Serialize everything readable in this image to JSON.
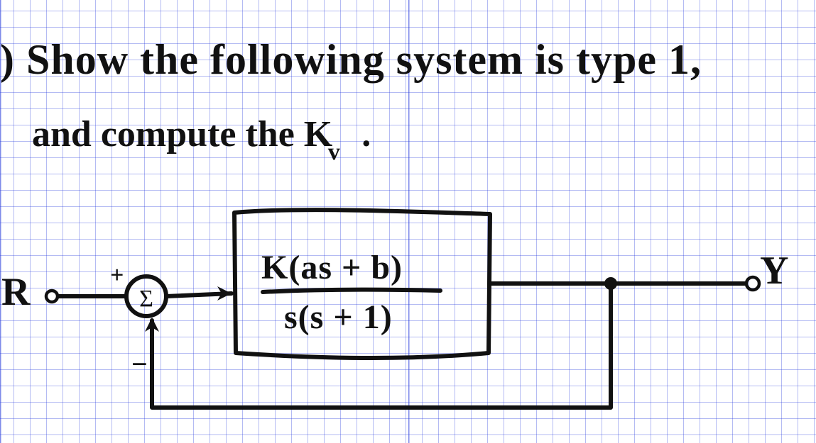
{
  "problem": {
    "line1": ") Show the following system is type 1,",
    "line2_prefix": "and compute the ",
    "symbol": "K",
    "subscript": "v",
    "period": "."
  },
  "diagram": {
    "input_label": "R",
    "output_label": "Y",
    "sum_sign_plus": "+",
    "sum_sign_minus": "−",
    "input_node": "o",
    "output_node": "o",
    "sum_glyph": "Σ",
    "transfer_function": {
      "numerator": "K(as + b)",
      "denominator": "s(s + 1)"
    }
  }
}
